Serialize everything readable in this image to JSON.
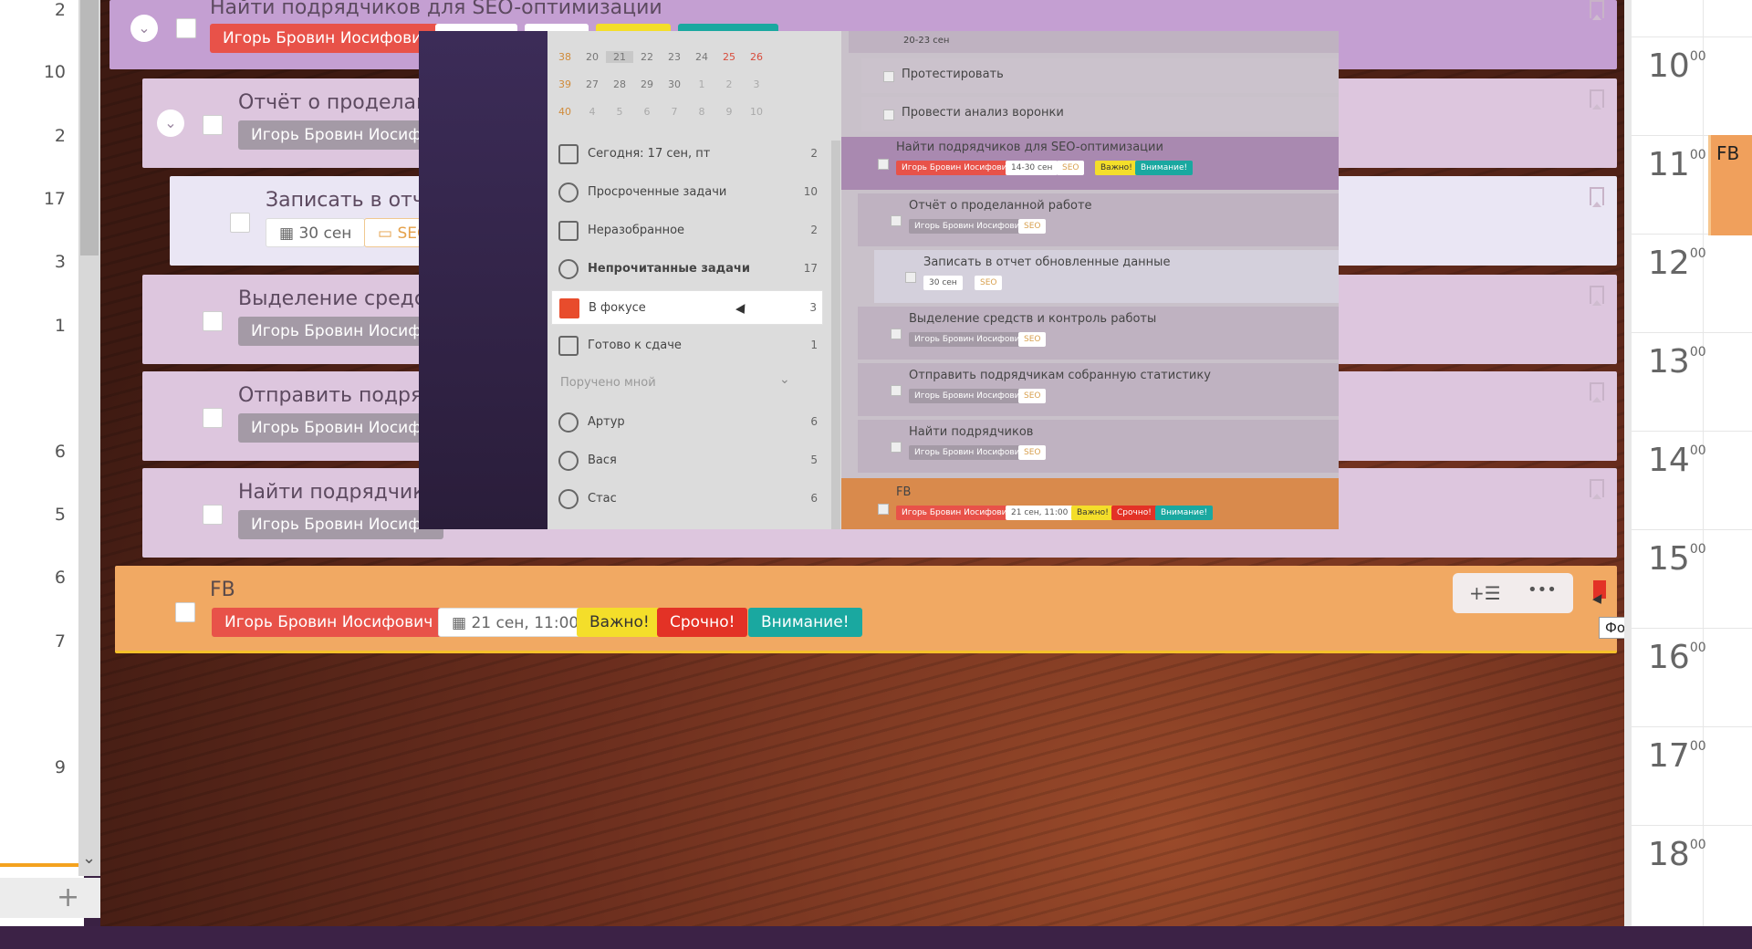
{
  "left_counts": [
    "2",
    "10",
    "2",
    "17",
    "3",
    "1",
    "6",
    "5",
    "6",
    "7",
    "9"
  ],
  "tasks": {
    "t1": {
      "title": "Найти подрядчиков для SEO-оптимизации",
      "user": "Игорь Бровин Иосифович"
    },
    "t2": {
      "title": "Отчёт о проделанн",
      "user": "Игорь Бровин Иосифо"
    },
    "t3": {
      "title": "Записать в отче",
      "date": "30 сен",
      "folder": "SEC"
    },
    "t4": {
      "title": "Выделение средств",
      "user": "Игорь Бровин Иосифо"
    },
    "t5": {
      "title": "Отправить подрядч",
      "user": "Игорь Бровин Иосифо"
    },
    "t6": {
      "title": "Найти подрядчиков",
      "user": "Игорь Бровин Иосифо"
    },
    "fb": {
      "title": "FB",
      "user": "Игорь Бровин Иосифович",
      "date": "21 сен, 11:00",
      "tag_important": "Важно!",
      "tag_urgent": "Срочно!",
      "tag_attention": "Внимание!",
      "tooltip": "Фокус",
      "more": "•••"
    }
  },
  "calendar": {
    "hours": [
      "10",
      "11",
      "12",
      "13",
      "14",
      "15",
      "16",
      "17",
      "18"
    ],
    "minutes": "00",
    "event_label": "FB"
  },
  "overlay": {
    "mini_calendar": [
      {
        "week": "38",
        "days": [
          "20",
          "21",
          "22",
          "23",
          "24",
          "25",
          "26"
        ]
      },
      {
        "week": "39",
        "days": [
          "27",
          "28",
          "29",
          "30",
          "1",
          "2",
          "3"
        ]
      },
      {
        "week": "40",
        "days": [
          "4",
          "5",
          "6",
          "7",
          "8",
          "9",
          "10"
        ]
      }
    ],
    "menu": [
      {
        "label": "Сегодня: 17 сен, пт",
        "count": "2"
      },
      {
        "label": "Просроченные задачи",
        "count": "10"
      },
      {
        "label": "Неразобранное",
        "count": "2"
      },
      {
        "label": "Непрочитанные задачи",
        "count": "17"
      },
      {
        "label": "В фокусе",
        "count": "3"
      },
      {
        "label": "Готово к сдаче",
        "count": "1"
      }
    ],
    "section_assigned": "Поручено мной",
    "people": [
      {
        "label": "Артур",
        "count": "6"
      },
      {
        "label": "Вася",
        "count": "5"
      },
      {
        "label": "Стас",
        "count": "6"
      }
    ],
    "main_rows": {
      "top_date": "20-23 сен",
      "r1": "Протестировать",
      "r2": "Провести анализ воронки",
      "r3": {
        "title": "Найти подрядчиков для SEO-оптимизации",
        "user": "Игорь Бровин Иосифович",
        "date": "14-30 сен",
        "folder": "SEO",
        "imp": "Важно!",
        "att": "Внимание!"
      },
      "r4": {
        "title": "Отчёт о проделанной работе",
        "user": "Игорь Бровин Иосифович",
        "folder": "SEO"
      },
      "r5": {
        "title": "Записать в отчет обновленные данные",
        "date": "30 сен",
        "folder": "SEO"
      },
      "r6": {
        "title": "Выделение средств и контроль работы",
        "user": "Игорь Бровин Иосифович",
        "folder": "SEO"
      },
      "r7": {
        "title": "Отправить подрядчикам собранную статистику",
        "user": "Игорь Бровин Иосифович",
        "folder": "SEO"
      },
      "r8": {
        "title": "Найти подрядчиков",
        "user": "Игорь Бровин Иосифович",
        "folder": "SEO"
      },
      "r9": {
        "title": "FB",
        "user": "Игорь Бровин Иосифович",
        "date": "21 сен, 11:00",
        "imp": "Важно!",
        "urg": "Срочно!",
        "att": "Внимание!"
      }
    }
  },
  "colors": {
    "task_purple": "#c49fd2",
    "task_light": "#ddc6de",
    "task_selected": "#eae6f4",
    "fb_orange": "#f1a963",
    "tag_red": "#e85249",
    "tag_yellow": "#f4de2a",
    "tag_urgent": "#e33226",
    "tag_teal": "#1aa8a0"
  }
}
